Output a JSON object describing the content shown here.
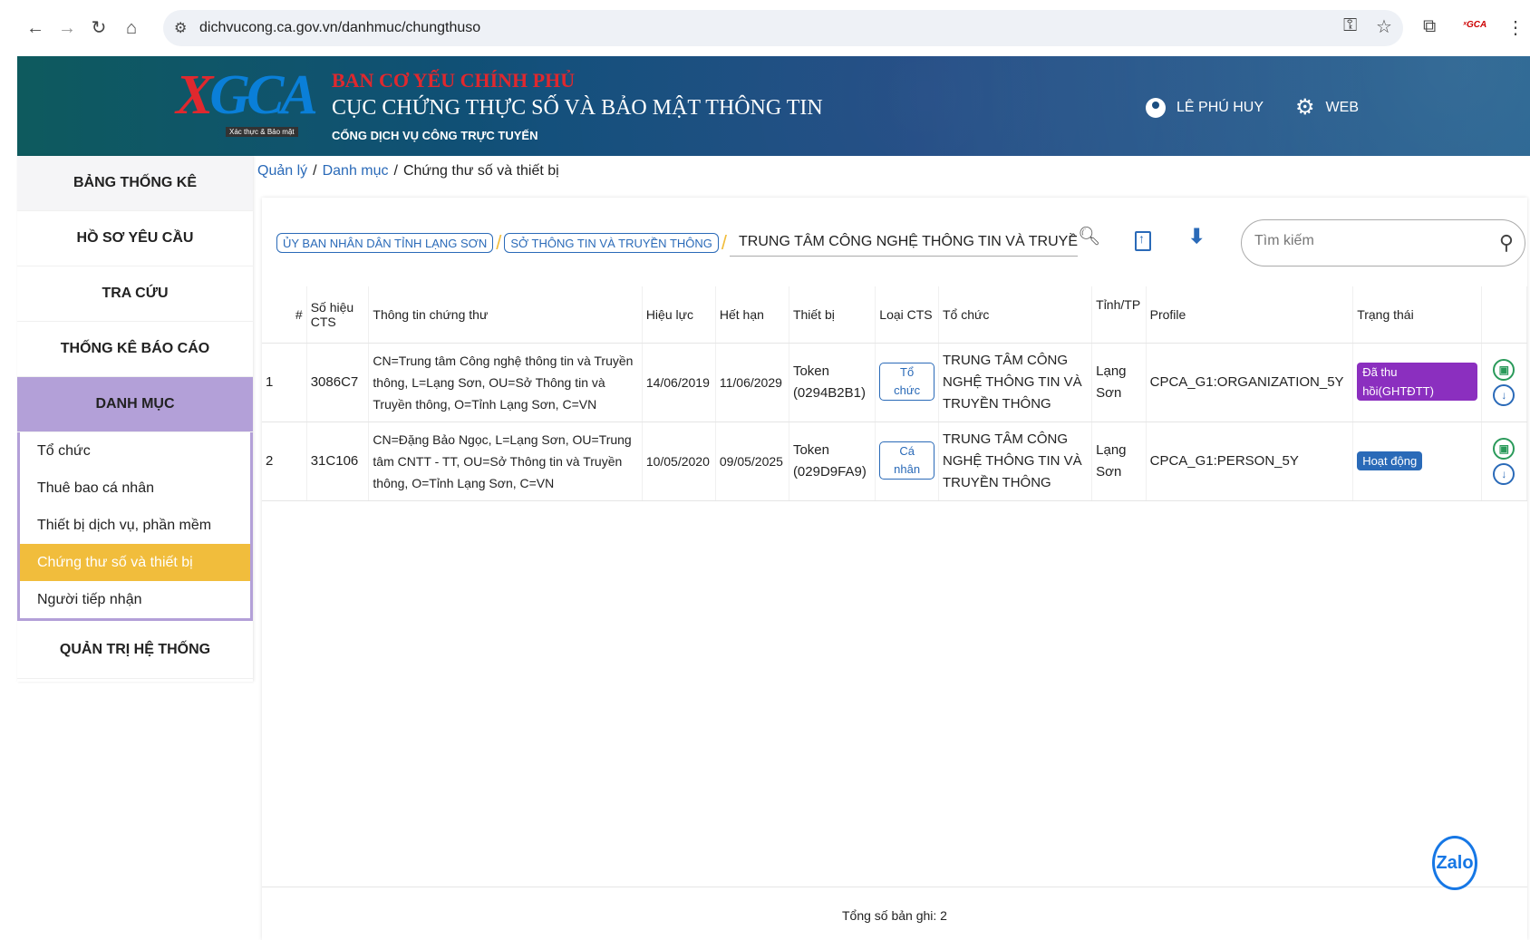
{
  "browser": {
    "url": "dichvucong.ca.gov.vn/danhmuc/chungthuso",
    "ext_logo": "ˣGCA"
  },
  "header": {
    "logo_text": "XGCA",
    "logo_sub": "Xác thực & Bảo mật",
    "title1": "BAN CƠ YẾU CHÍNH PHỦ",
    "title2": "CỤC CHỨNG THỰC SỐ VÀ BẢO MẬT THÔNG TIN",
    "title3": "CỔNG DỊCH VỤ CÔNG TRỰC TUYẾN",
    "user_name": "LÊ PHÚ HUY",
    "web_label": "WEB"
  },
  "sidebar": {
    "items": [
      {
        "label": "BẢNG THỐNG KÊ"
      },
      {
        "label": "HỒ SƠ YÊU CẦU"
      },
      {
        "label": "TRA CỨU"
      },
      {
        "label": "THỐNG KÊ BÁO CÁO"
      },
      {
        "label": "DANH MỤC"
      }
    ],
    "submenu": [
      {
        "label": "Tổ chức"
      },
      {
        "label": "Thuê bao cá nhân"
      },
      {
        "label": "Thiết bị dịch vụ, phần mềm"
      },
      {
        "label": "Chứng thư số và thiết bị"
      },
      {
        "label": "Người tiếp nhận"
      }
    ],
    "last": "QUẢN TRỊ HỆ THỐNG"
  },
  "breadcrumb": {
    "l1": "Quản lý",
    "l2": "Danh mục",
    "current": "Chứng thư số và thiết bị"
  },
  "filters": {
    "chip1": "ỦY BAN NHÂN DÂN TỈNH LẠNG SƠN",
    "chip2": "SỞ THÔNG TIN VÀ TRUYỀN THÔNG",
    "field_value": "TRUNG TÂM CÔNG NGHỆ THÔNG TIN VÀ TRUYỀN THÔNG",
    "search_placeholder": "Tìm kiếm"
  },
  "table": {
    "headers": {
      "num": "#",
      "serial": "Số hiệu CTS",
      "info": "Thông tin chứng thư",
      "valid": "Hiệu lực",
      "expire": "Hết hạn",
      "device": "Thiết bị",
      "type": "Loại CTS",
      "org": "Tổ chức",
      "province": "Tỉnh/TP",
      "profile": "Profile",
      "status": "Trạng thái"
    },
    "rows": [
      {
        "num": "1",
        "serial": "3086C7",
        "info": "CN=Trung tâm Công nghệ thông tin và Truyền thông, L=Lạng Sơn, OU=Sở Thông tin và Truyền thông, O=Tỉnh Lạng Sơn, C=VN",
        "valid": "14/06/2019",
        "expire": "11/06/2029",
        "device": "Token (0294B2B1)",
        "type": "Tổ chức",
        "org": "TRUNG TÂM CÔNG NGHỆ THÔNG TIN VÀ TRUYỀN THÔNG",
        "province": "Lạng Sơn",
        "profile": "CPCA_G1:ORGANIZATION_5Y",
        "status": "Đã thu hồi(GHTĐTT)"
      },
      {
        "num": "2",
        "serial": "31C106",
        "info": "CN=Đặng Bảo Ngọc, L=Lạng Sơn, OU=Trung tâm CNTT - TT, OU=Sở Thông tin và Truyền thông, O=Tỉnh Lạng Sơn, C=VN",
        "valid": "10/05/2020",
        "expire": "09/05/2025",
        "device": "Token (029D9FA9)",
        "type": "Cá nhân",
        "org": "TRUNG TÂM CÔNG NGHỆ THÔNG TIN VÀ TRUYỀN THÔNG",
        "province": "Lạng Sơn",
        "profile": "CPCA_G1:PERSON_5Y",
        "status": "Hoạt động"
      }
    ]
  },
  "footer": {
    "total": "Tổng số bản ghi: 2"
  },
  "zalo": "Zalo",
  "colors": {
    "accent": "#2a6ab8",
    "sidebar_active": "#b3a0d8",
    "submenu_active": "#f1bd3c",
    "status_revoked": "#8b2fbf"
  }
}
